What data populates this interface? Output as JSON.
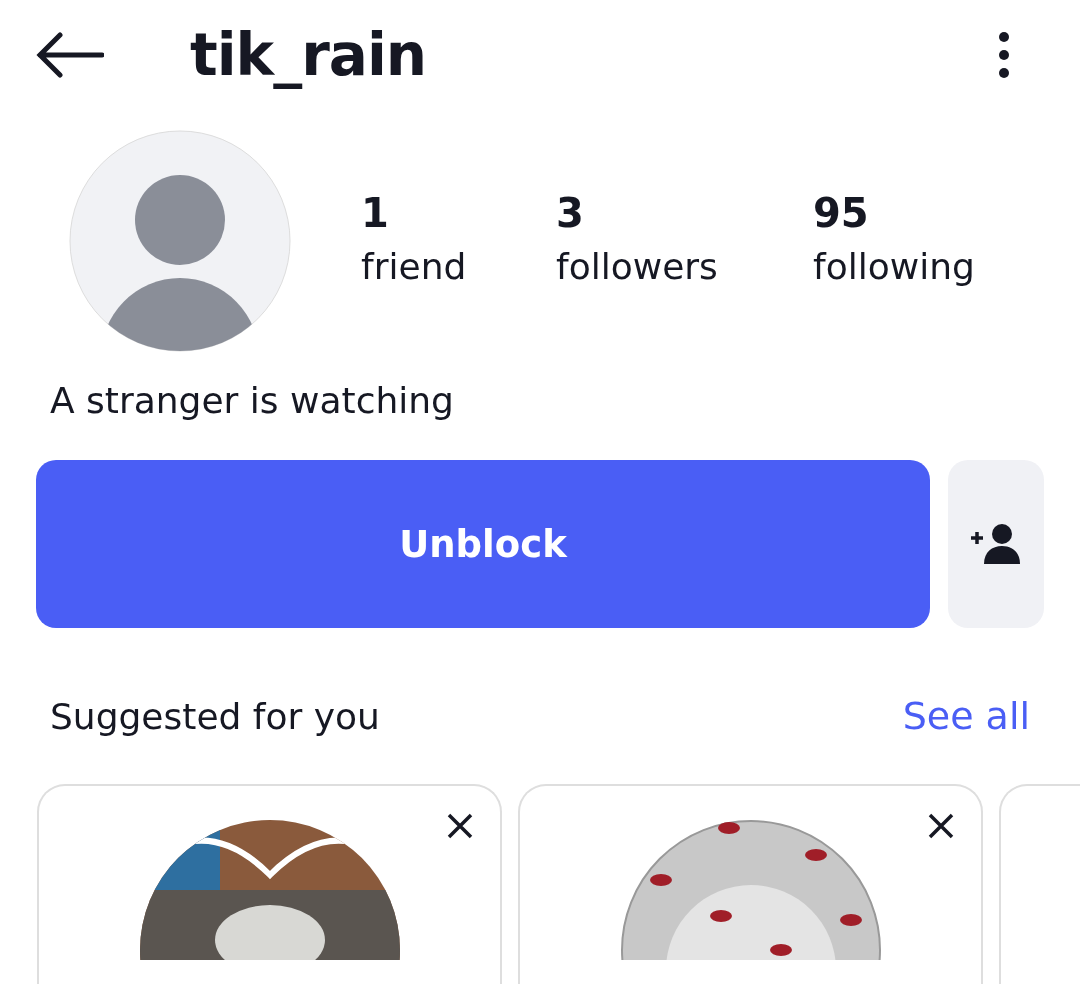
{
  "header": {
    "title": "tik_rain"
  },
  "profile": {
    "stats": [
      {
        "value": "1",
        "label": "friend"
      },
      {
        "value": "3",
        "label": "followers"
      },
      {
        "value": "95",
        "label": "following"
      }
    ],
    "bio": "A stranger is watching"
  },
  "actions": {
    "primary": "Unblock"
  },
  "suggestions": {
    "title": "Suggested for you",
    "link": "See all",
    "cards": [
      {
        "kind": "picture"
      },
      {
        "kind": "pattern"
      },
      {
        "kind": "partial"
      }
    ]
  }
}
